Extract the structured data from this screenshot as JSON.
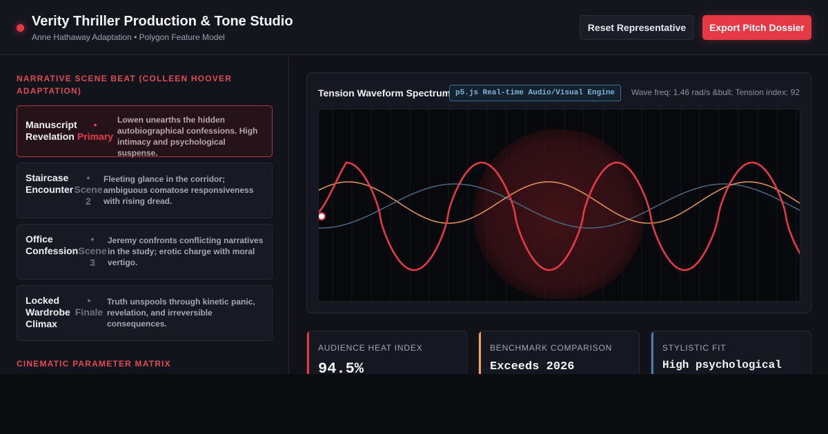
{
  "header": {
    "title": "Verity Thriller Production & Tone Studio",
    "subtitle": "Anne Hathaway Adaptation • Polygon Feature Model",
    "reset_label": "Reset Representative",
    "export_label": "Export Pitch Dossier"
  },
  "narrative": {
    "section_label": "NARRATIVE SCENE BEAT (COLLEEN HOOVER ADAPTATION)",
    "beats": [
      {
        "name": "Manuscript Revelation",
        "tag": "• Primary",
        "desc": "Lowen unearths the hidden autobiographical confessions. High intimacy and psychological suspense.",
        "active": true
      },
      {
        "name": "Staircase Encounter",
        "tag": "• Scene 2",
        "desc": "Fleeting glance in the corridor; ambiguous comatose responsiveness with rising dread.",
        "active": false
      },
      {
        "name": "Office Confession",
        "tag": "• Scene 3",
        "desc": "Jeremy confronts conflicting narratives in the study; erotic charge with moral vertigo.",
        "active": false
      },
      {
        "name": "Locked Wardrobe Climax",
        "tag": "• Finale",
        "desc": "Truth unspools through kinetic panic, revelation, and irreversible consequences.",
        "active": false
      }
    ]
  },
  "matrix": {
    "section_label": "CINEMATIC PARAMETER MATRIX"
  },
  "waveform": {
    "title": "Tension Waveform Spectrum",
    "engine_badge": "p5.js Real-time Audio/Visual Engine",
    "meta": "Wave freq: 1.46 rad/s &bull; Tension index: 92",
    "colors": {
      "primary": "#e63946",
      "secondary": "#e0915a",
      "tertiary": "#4a6a85"
    }
  },
  "metrics": [
    {
      "label": "AUDIENCE HEAT INDEX",
      "value": "94.5%",
      "color": "#e63946"
    },
    {
      "label": "BENCHMARK COMPARISON",
      "value": "Exceeds 2026",
      "color": "#f0a35e"
    },
    {
      "label": "STYLISTIC FIT",
      "value": "High psychological",
      "color": "#4a7da8"
    }
  ],
  "colors": {
    "accent": "#e63946",
    "background": "#101218",
    "panel": "#151821"
  }
}
